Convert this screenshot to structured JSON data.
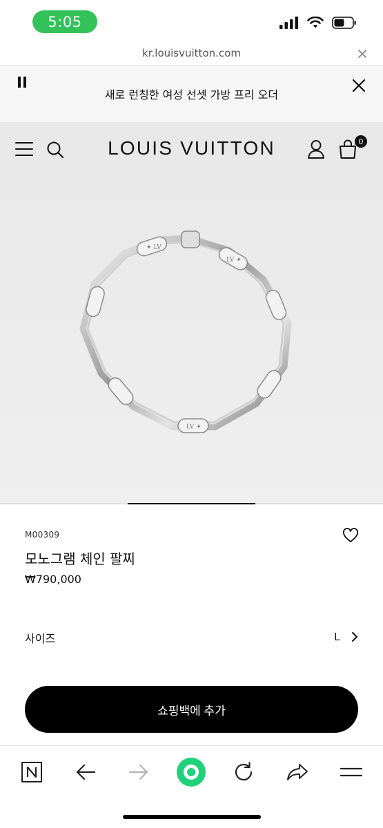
{
  "status": {
    "time": "5:05",
    "accent": "#33c25a"
  },
  "browser": {
    "url": "kr.louisvuitton.com"
  },
  "promo": {
    "text": "새로 런칭한 여성 선셋 가방 프리 오더"
  },
  "header": {
    "brand": "LOUIS VUITTON",
    "bag_count": "0"
  },
  "product": {
    "sku": "M00309",
    "name": "모노그램 체인 팔찌",
    "price": "₩790,000",
    "size_label": "사이즈",
    "size_value": "L",
    "add_to_bag": "쇼핑백에 추가"
  },
  "carousel": {
    "active_index": 2,
    "total": 3
  },
  "toolbar": {
    "icons": [
      "n-logo-icon",
      "back-arrow-icon",
      "forward-arrow-icon",
      "green-home-icon",
      "reload-icon",
      "share-icon",
      "menu-icon"
    ],
    "brand_color": "#1ed27a"
  }
}
